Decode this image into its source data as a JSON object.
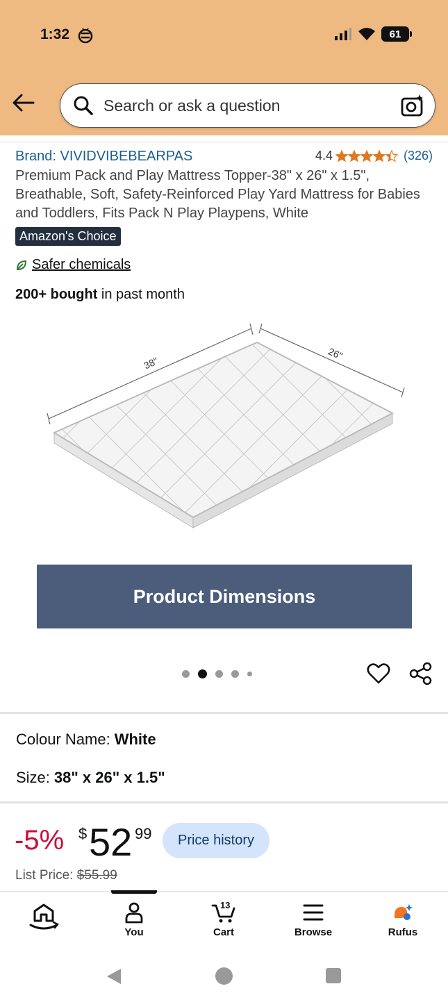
{
  "status_bar": {
    "time": "1:32",
    "battery": "61"
  },
  "search": {
    "placeholder": "Search or ask a question"
  },
  "product": {
    "brand": "Brand: VIVIDVIBEBEARPAS",
    "rating": "4.4",
    "rating_value": 4.4,
    "rating_count": "(326)",
    "title": "Premium Pack and Play Mattress Topper-38\" x 26\" x 1.5\", Breathable, Soft, Safety-Reinforced Play Yard Mattress for Babies and Toddlers, Fits Pack N Play Playpens, White",
    "badge": "Amazon's Choice",
    "safer_chemicals": "Safer chemicals",
    "bought_bold": "200+ bought",
    "bought_rest": " in past month"
  },
  "image": {
    "dim_length": "38\"",
    "dim_width": "26\"",
    "banner": "Product Dimensions",
    "carousel_count": 5,
    "carousel_active": 2
  },
  "options": {
    "colour_label": "Colour Name:",
    "colour_value": "White",
    "size_label": "Size:",
    "size_value": "38\" x 26\" x 1.5\""
  },
  "price": {
    "discount": "-5%",
    "currency": "$",
    "whole": "52",
    "cents": "99",
    "history_button": "Price history",
    "list_label": "List Price:",
    "list_value": "$55.99"
  },
  "nav": {
    "home": "",
    "you": "You",
    "cart": "Cart",
    "cart_count": "13",
    "browse": "Browse",
    "rufus": "Rufus"
  },
  "colors": {
    "header_bg": "#efb982",
    "link": "#1a5e8f",
    "star": "#de7921",
    "discount": "#cc0c39",
    "banner": "#4b5d7a",
    "price_history_bg": "#d3e4fb"
  }
}
